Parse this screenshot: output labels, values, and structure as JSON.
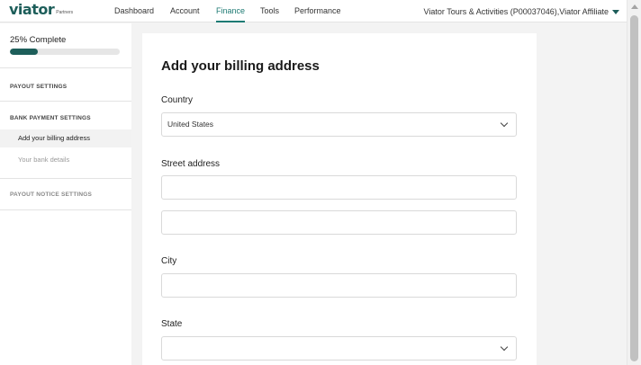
{
  "brand": {
    "logo": "viator",
    "sub": "Partners"
  },
  "nav": {
    "items": [
      "Dashboard",
      "Account",
      "Finance",
      "Tools",
      "Performance"
    ],
    "active": "Finance",
    "account_label": "Viator Tours & Activities (P00037046),Viator Affiliate"
  },
  "sidebar": {
    "progress_label": "25% Complete",
    "progress_fraction": 0.25,
    "sections": [
      {
        "heading": "PAYOUT SETTINGS"
      },
      {
        "heading": "BANK PAYMENT SETTINGS",
        "items": [
          "Add your billing address",
          "Your bank details"
        ]
      },
      {
        "heading": "PAYOUT NOTICE SETTINGS"
      }
    ],
    "selected_item": "Add your billing address"
  },
  "form": {
    "title": "Add your billing address",
    "country_label": "Country",
    "country_value": "United States",
    "street_label": "Street address",
    "street_line1": "",
    "street_line2": "",
    "city_label": "City",
    "city_value": "",
    "state_label": "State",
    "state_value": ""
  },
  "colors": {
    "brand": "#1d5e5a",
    "nav_active": "#1d7a73",
    "page_bg": "#f3f3f3"
  }
}
